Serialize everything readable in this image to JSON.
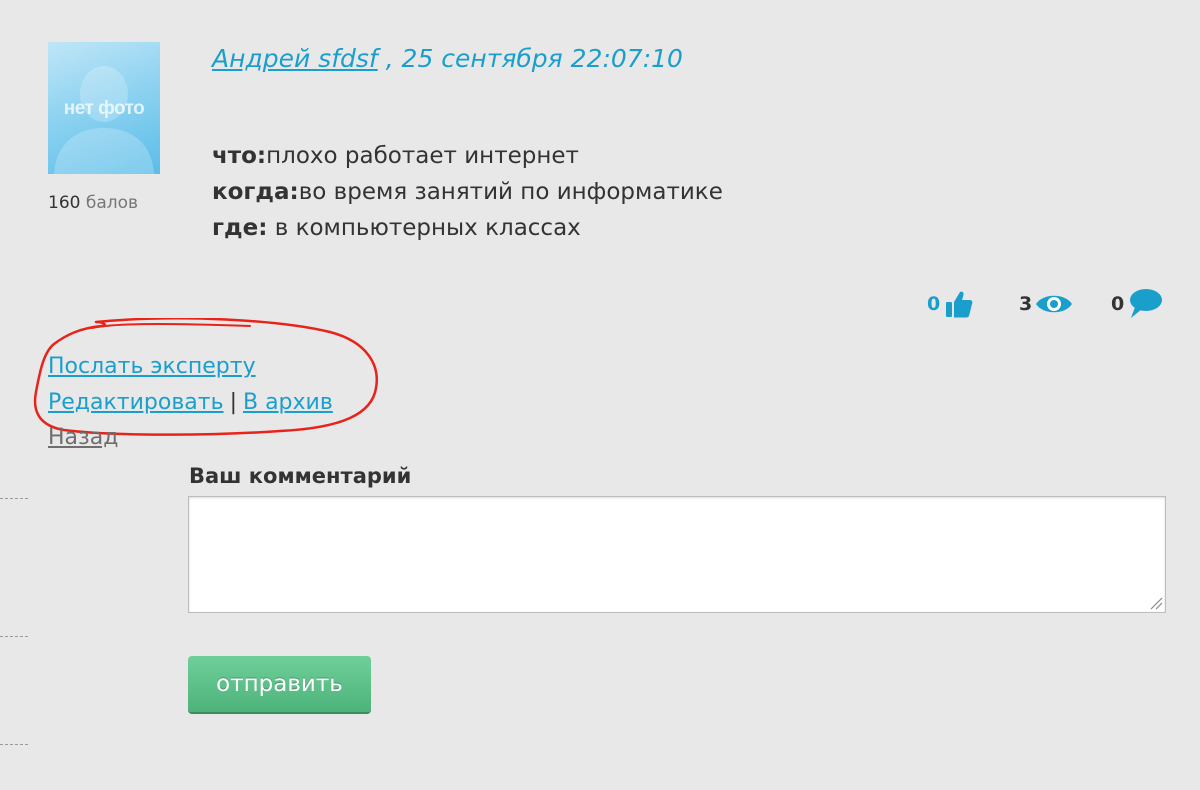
{
  "colors": {
    "link": "#1a9fcd",
    "accent_green": "#5cc08a",
    "annotation_red": "#e8231a",
    "background": "#e8e8e8"
  },
  "user": {
    "avatar_placeholder": "нет фото",
    "score_value": "160",
    "score_unit": "балов"
  },
  "post": {
    "author": "Андрей sfdsf",
    "date_sep": " , ",
    "date": "25 сентября 22:07:10",
    "lines": [
      {
        "label": "что:",
        "text": "плохо работает интернет"
      },
      {
        "label": "когда:",
        "text": "во время занятий по информатике"
      },
      {
        "label": "где:",
        "text": " в компьютерных классах"
      }
    ]
  },
  "stats": {
    "likes": {
      "value": "0",
      "icon": "thumbs-up-icon"
    },
    "views": {
      "value": "3",
      "icon": "eye-icon"
    },
    "comments": {
      "value": "0",
      "icon": "speech-bubble-icon"
    }
  },
  "actions": {
    "send_expert": "Послать эксперту",
    "edit": "Редактировать",
    "separator": "|",
    "archive": "В архив",
    "back": "Назад"
  },
  "comment_form": {
    "label": "Ваш комментарий",
    "value": "",
    "submit_label": "отправить"
  }
}
